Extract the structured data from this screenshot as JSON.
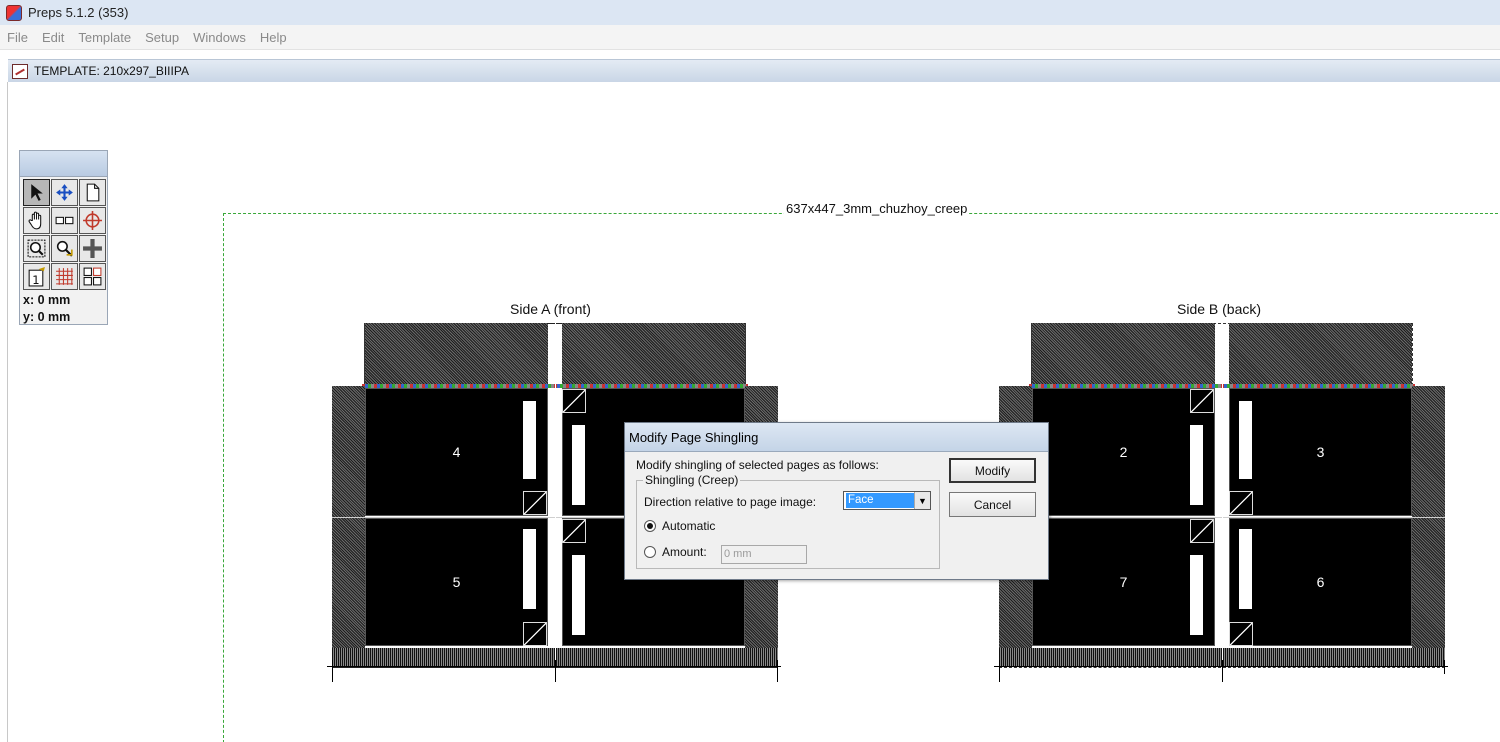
{
  "window": {
    "title": "Preps 5.1.2 (353)"
  },
  "menu": [
    "File",
    "Edit",
    "Template",
    "Setup",
    "Windows",
    "Help"
  ],
  "document": {
    "title": "TEMPLATE: 210x297_BIIIPA"
  },
  "toolbox": {
    "tools": [
      "select-arrow-icon",
      "move-icon",
      "page-icon",
      "hand-icon",
      "spacing-icon",
      "target-icon",
      "zoom-in-icon",
      "zoom-out-icon",
      "cross-icon",
      "page-number-icon",
      "grid-icon",
      "layout-icon"
    ],
    "x_label": "x: 0 mm",
    "y_label": "y: 0 mm"
  },
  "canvas": {
    "sheet_name": "637x447_3mm_chuzhoy_creep",
    "side_a_label": "Side A (front)",
    "side_b_label": "Side B (back)",
    "side_a_pages": [
      "4",
      "",
      "5",
      ""
    ],
    "side_b_pages": [
      "2",
      "3",
      "7",
      "6"
    ]
  },
  "dialog": {
    "title": "Modify Page Shingling",
    "description": "Modify shingling of selected pages as follows:",
    "group_label": "Shingling (Creep)",
    "direction_label": "Direction relative to page image:",
    "direction_value": "Face",
    "automatic_label": "Automatic",
    "amount_label": "Amount:",
    "amount_value": "0 mm",
    "modify_button": "Modify",
    "cancel_button": "Cancel"
  }
}
